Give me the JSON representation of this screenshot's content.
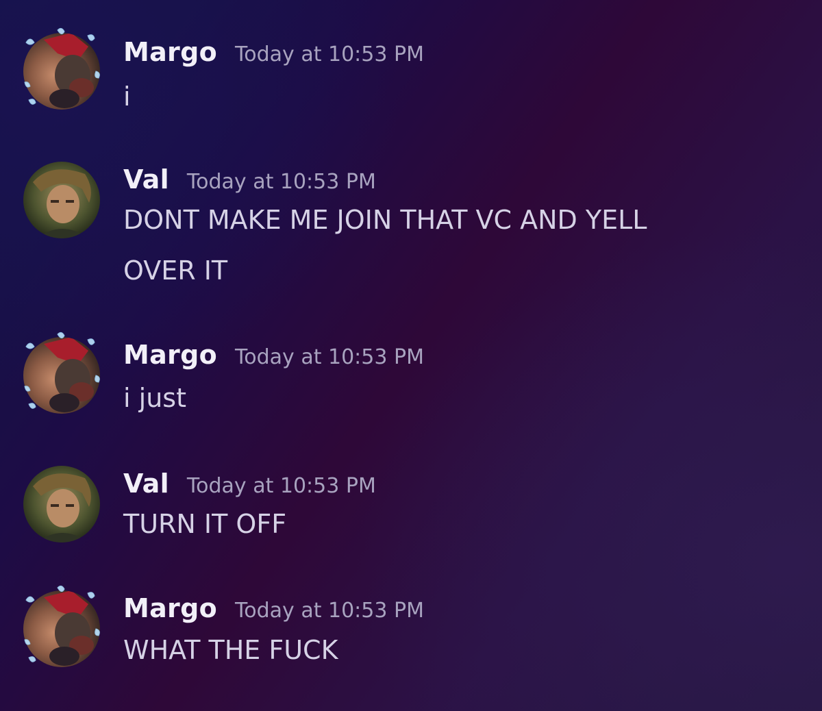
{
  "messages": [
    {
      "author": "Margo",
      "timestamp": "Today at 10:53 PM",
      "lines": [
        "i"
      ],
      "avatar": "margo-avatar"
    },
    {
      "author": "Val",
      "timestamp": "Today at 10:53 PM",
      "lines": [
        "DONT MAKE ME JOIN THAT VC AND YELL",
        "OVER IT"
      ],
      "avatar": "val-avatar"
    },
    {
      "author": "Margo",
      "timestamp": "Today at 10:53 PM",
      "lines": [
        "i just"
      ],
      "avatar": "margo-avatar"
    },
    {
      "author": "Val",
      "timestamp": "Today at 10:53 PM",
      "lines": [
        "TURN IT OFF"
      ],
      "avatar": "val-avatar"
    },
    {
      "author": "Margo",
      "timestamp": "Today at 10:53 PM",
      "lines": [
        "WHAT THE FUCK"
      ],
      "avatar": "margo-avatar"
    }
  ]
}
